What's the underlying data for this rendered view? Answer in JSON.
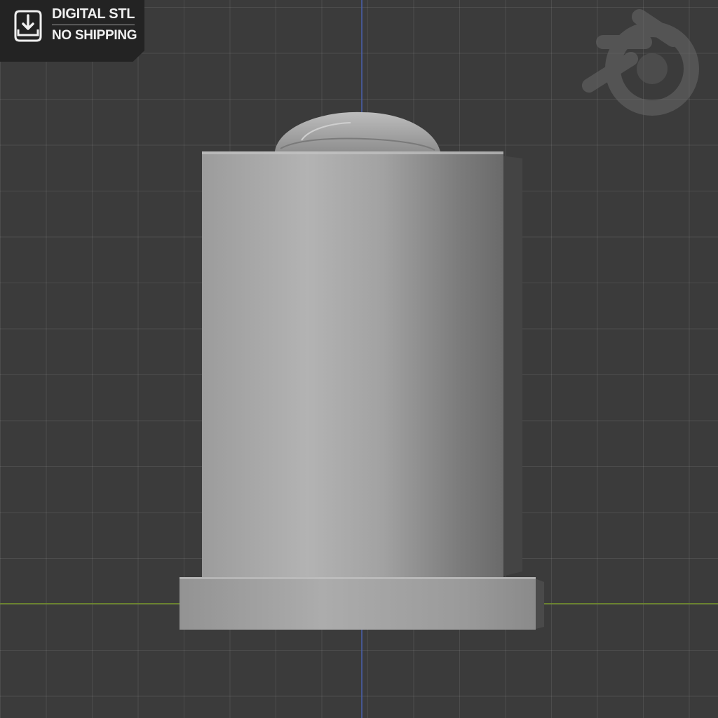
{
  "badge": {
    "line1": "DIGITAL STL",
    "line2": "NO SHIPPING",
    "icon": "download-icon"
  },
  "watermark": {
    "icon": "blender-logo-icon"
  },
  "viewport": {
    "background": "#3b3b3b",
    "grid_color": "#555555",
    "axis_x_color": "#6f8a2e",
    "axis_y_color": "#4a5fa8"
  },
  "model": {
    "color": "#a6a6a6"
  }
}
